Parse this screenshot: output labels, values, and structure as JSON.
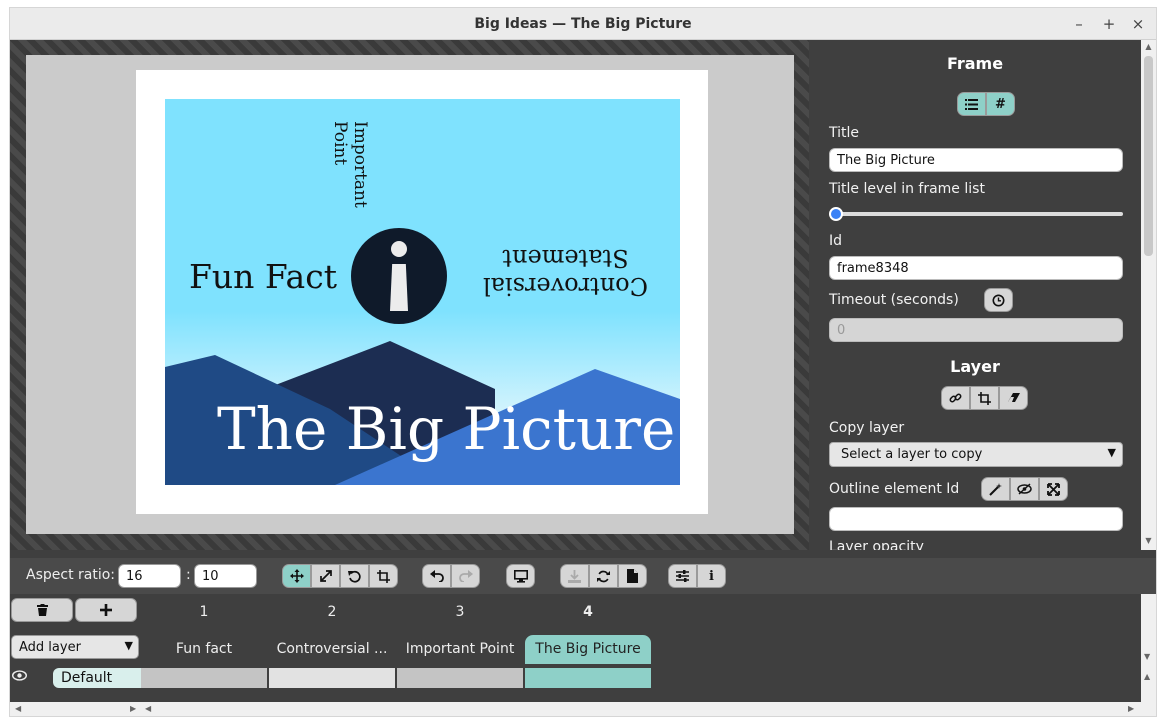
{
  "window": {
    "title": "Big Ideas — The Big Picture",
    "min": "–",
    "max": "+",
    "close": "×"
  },
  "slide": {
    "fun_fact": "Fun Fact",
    "controversial_line1": "Controversial",
    "controversial_line2": "Statement",
    "important_line1": "Important",
    "important_line2": "Point",
    "big_title": "The Big Picture"
  },
  "panel": {
    "frame_heading": "Frame",
    "title_label": "Title",
    "title_value": "The Big Picture",
    "title_level_label": "Title level in frame list",
    "id_label": "Id",
    "id_value": "frame8348",
    "timeout_label": "Timeout (seconds)",
    "timeout_placeholder": "0",
    "layer_heading": "Layer",
    "copy_layer_label": "Copy layer",
    "copy_layer_select": "Select a layer to copy",
    "outline_label": "Outline element Id",
    "outline_value": "",
    "opacity_label": "Layer opacity"
  },
  "toolbar": {
    "aspect_label": "Aspect ratio:",
    "aspect_w": "16",
    "aspect_sep": ":",
    "aspect_h": "10"
  },
  "timeline": {
    "add_layer": "Add layer",
    "frames": [
      {
        "number": "1",
        "title": "Fun fact"
      },
      {
        "number": "2",
        "title": "Controversial ..."
      },
      {
        "number": "3",
        "title": "Important Point"
      },
      {
        "number": "4",
        "title": "The Big Picture"
      }
    ],
    "layer_name": "Default"
  },
  "colors": {
    "accent": "#8ed0c8",
    "sky": "#7fe2fe",
    "mountain_dark": "#1c2d52",
    "mountain_mid": "#1f4a85",
    "mountain_light": "#3b75cf"
  },
  "icons": [
    "list-icon",
    "hash-icon",
    "clock-icon",
    "link-icon",
    "crop-icon",
    "eraser-icon",
    "magic-wand-icon",
    "eye-slash-icon",
    "expand-icon",
    "move-icon",
    "resize-icon",
    "rotate-icon",
    "undo-icon",
    "redo-icon",
    "monitor-icon",
    "download-icon",
    "refresh-icon",
    "file-icon",
    "sliders-icon",
    "info-icon",
    "trash-icon",
    "plus-icon",
    "eye-icon"
  ]
}
